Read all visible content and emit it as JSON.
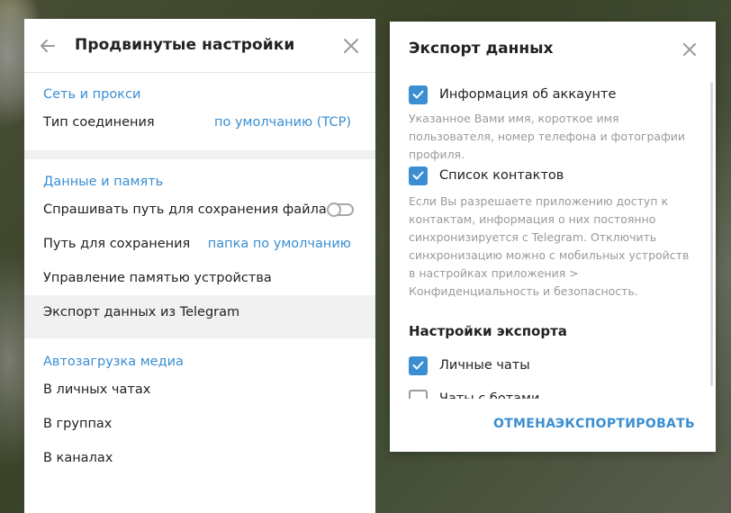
{
  "settings": {
    "title": "Продвинутые настройки",
    "sections": [
      {
        "title": "Сеть и прокси",
        "rows": [
          {
            "label": "Тип соединения",
            "value": "по умолчанию (TCP)"
          }
        ]
      },
      {
        "title": "Данные и память",
        "rows": [
          {
            "label": "Спрашивать путь для сохранения файла",
            "toggle": false
          },
          {
            "label": "Путь для сохранения",
            "value": "папка по умолчанию"
          },
          {
            "label": "Управление памятью устройства"
          },
          {
            "label": "Экспорт данных из Telegram",
            "active": true
          }
        ]
      },
      {
        "title": "Автозагрузка медиа",
        "rows": [
          {
            "label": "В личных чатах"
          },
          {
            "label": "В группах"
          },
          {
            "label": "В каналах"
          }
        ]
      }
    ]
  },
  "dialog": {
    "title": "Экспорт данных",
    "items": [
      {
        "label": "Информация об аккаунте",
        "checked": true,
        "description": "Указанное Вами имя, короткое имя пользователя, номер телефона и фотографии профиля."
      },
      {
        "label": "Список контактов",
        "checked": true,
        "description": "Если Вы разрешаете приложению доступ к контактам, информация о них постоянно синхронизируется с Telegram. Отключить синхронизацию можно с мобильных устройств в настройках приложения > Конфиденциальность и безопасность."
      }
    ],
    "export_settings_title": "Настройки экспорта",
    "export_options": [
      {
        "label": "Личные чаты",
        "checked": true
      },
      {
        "label": "Чаты с ботами",
        "checked": false
      }
    ],
    "cancel_label": "ОТМЕНА",
    "export_label": "ЭКСПОРТИРОВАТЬ"
  },
  "colors": {
    "accent": "#3a8ed1",
    "text": "#222222",
    "muted": "#9a9a9a"
  }
}
